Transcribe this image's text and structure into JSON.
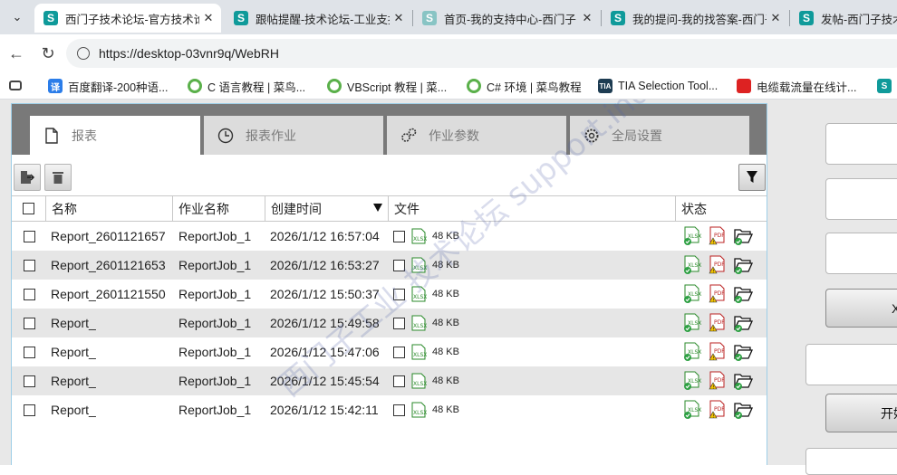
{
  "browser": {
    "tabs": [
      {
        "title": "西门子技术论坛-官方技术论坛",
        "icon": "siemens-s-icon",
        "active": true
      },
      {
        "title": "跟帖提醒-技术论坛-工业支持",
        "icon": "siemens-s-icon",
        "active": false
      },
      {
        "title": "首页-我的支持中心-西门子（",
        "icon": "siemens-s-icon",
        "active": false
      },
      {
        "title": "我的提问-我的找答案-西门子",
        "icon": "siemens-s-icon",
        "active": false
      },
      {
        "title": "发帖-西门子技术",
        "icon": "siemens-s-icon",
        "active": false
      }
    ],
    "url": "https://desktop-03vnr9q/WebRH",
    "bookmarks": [
      {
        "label": "百度翻译-200种语...",
        "icon": "translate-icon"
      },
      {
        "label": "C 语言教程 | 菜鸟...",
        "icon": "runoob-icon"
      },
      {
        "label": "VBScript 教程 | 菜...",
        "icon": "runoob-icon"
      },
      {
        "label": "C# 环境 | 菜鸟教程",
        "icon": "runoob-icon"
      },
      {
        "label": "TIA Selection Tool...",
        "icon": "tia-icon"
      },
      {
        "label": "电缆载流量在线计...",
        "icon": "cable-icon"
      }
    ]
  },
  "app": {
    "tabs": [
      {
        "label": "报表",
        "icon": "document-icon",
        "active": true
      },
      {
        "label": "报表作业",
        "icon": "clock-icon",
        "active": false
      },
      {
        "label": "作业参数",
        "icon": "cogs-icon",
        "active": false
      },
      {
        "label": "全局设置",
        "icon": "gear-icon",
        "active": false
      }
    ],
    "columns": [
      "名称",
      "作业名称",
      "创建时间",
      "文件",
      "状态"
    ],
    "sort_column": "创建时间",
    "sort_direction": "descending",
    "rows": [
      {
        "name": "Report_2601121657",
        "job": "ReportJob_1",
        "created": "2026/1/12 16:57:04",
        "size": "48 KB"
      },
      {
        "name": "Report_2601121653",
        "job": "ReportJob_1",
        "created": "2026/1/12 16:53:27",
        "size": "48 KB"
      },
      {
        "name": "Report_2601121550",
        "job": "ReportJob_1",
        "created": "2026/1/12 15:50:37",
        "size": "48 KB"
      },
      {
        "name": "Report_",
        "job": "ReportJob_1",
        "created": "2026/1/12 15:49:58",
        "size": "48 KB"
      },
      {
        "name": "Report_",
        "job": "ReportJob_1",
        "created": "2026/1/12 15:47:06",
        "size": "48 KB"
      },
      {
        "name": "Report_",
        "job": "ReportJob_1",
        "created": "2026/1/12 15:45:54",
        "size": "48 KB"
      },
      {
        "name": "Report_",
        "job": "ReportJob_1",
        "created": "2026/1/12 15:42:11",
        "size": "48 KB"
      }
    ],
    "right_buttons": [
      "X",
      "开始"
    ]
  },
  "watermark": "西门子工业 技术论坛 support.industry.siemens.com/cs"
}
